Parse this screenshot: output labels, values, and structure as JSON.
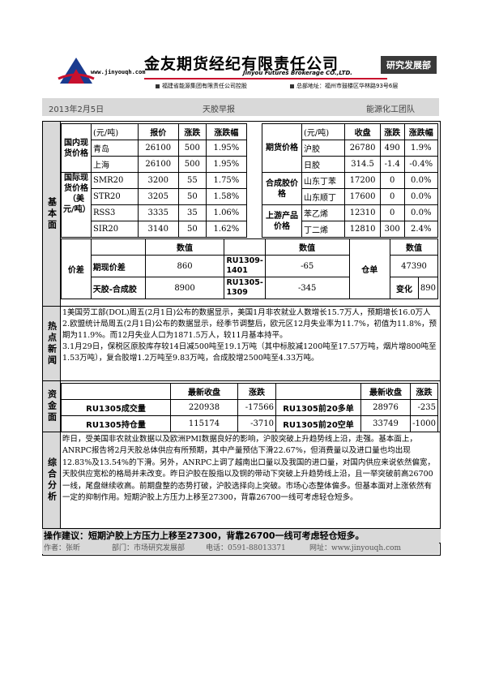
{
  "header": {
    "company_cn": "金友期货经纪有限责任公司",
    "url": "www.jinyouqh.com",
    "company_en": "Jinyou Futures Brokerage CO.,LTD.",
    "dept_badge": "研究发展部",
    "sub_left": "福建省能源集团有限责任公司控股",
    "sub_right": "总部地址：福州市鼓楼区华林路93号6层"
  },
  "topbar": {
    "date": "2013年2月5日",
    "title": "天胶早报",
    "team": "能源化工团队"
  },
  "sections": {
    "basic": "基本面",
    "hot": "热点新闻",
    "funds": "资金面",
    "analysis": "综合分析"
  },
  "domestic_spot": {
    "label": "国内现货价格",
    "headers": [
      "(元/吨)",
      "报价",
      "涨跌",
      "涨跌幅"
    ],
    "rows": [
      [
        "青岛",
        "26100",
        "500",
        "1.95%"
      ],
      [
        "上海",
        "26100",
        "500",
        "1.95%"
      ]
    ]
  },
  "intl_spot": {
    "label": "国际现货价格（美元/吨）",
    "rows": [
      [
        "SMR20",
        "3200",
        "55",
        "1.75%"
      ],
      [
        "STR20",
        "3205",
        "50",
        "1.58%"
      ],
      [
        "RSS3",
        "3335",
        "35",
        "1.06%"
      ],
      [
        "SIR20",
        "3140",
        "50",
        "1.62%"
      ]
    ]
  },
  "futures": {
    "label": "期货价格",
    "headers": [
      "(元/吨)",
      "收盘",
      "涨跌",
      "涨跌幅"
    ],
    "rows": [
      [
        "沪胶",
        "26780",
        "490",
        "1.9%"
      ],
      [
        "日胶",
        "314.5",
        "-1.4",
        "-0.4%"
      ]
    ]
  },
  "synthetic": {
    "label": "合成胶价格",
    "rows": [
      [
        "山东丁苯",
        "17200",
        "0",
        "0.0%"
      ],
      [
        "山东顺丁",
        "17600",
        "0",
        "0.0%"
      ]
    ]
  },
  "upstream": {
    "label": "上游产品价格",
    "rows": [
      [
        "苯乙烯",
        "12310",
        "0",
        "0.0%"
      ],
      [
        "丁二烯",
        "12810",
        "300",
        "2.4%"
      ]
    ]
  },
  "spread": {
    "label": "价差",
    "value_header": "数值",
    "rows": [
      {
        "name": "期现价差",
        "value": "860",
        "contract": "RU1309-1401",
        "contract_value": "-65"
      },
      {
        "name": "天胶-合成胶",
        "value": "8900",
        "contract": "RU1305-1309",
        "contract_value": "-345"
      }
    ],
    "warrant_label": "仓单",
    "warrant_value": "47390",
    "change_label": "变化",
    "change_value": "890"
  },
  "hot_news": [
    "1美国劳工部(DOL)周五(2月1日)公布的数据显示，美国1月非农就业人数增长15.7万人，预期增长16.0万人",
    "2.欧盟统计局周五(2月1日)公布的数据显示，经季节调整后，欧元区12月失业率为11.7%，初值为11.8%，预期为11.9%。而12月失业人口为1871.5万人，较11月基本持平。",
    "3.1月29日，保税区原胶库存较14日减500吨至19.1万吨（其中标胶减1200吨至17.57万吨，烟片增800吨至1.53万吨），复合胶增1.2万吨至9.83万吨，合成胶增2500吨至4.33万吨。"
  ],
  "funds": {
    "headers": [
      "最新收盘",
      "涨跌",
      "最新收盘",
      "涨跌"
    ],
    "rows": [
      {
        "name": "RU1305成交量",
        "close": "220938",
        "change": "-17566",
        "name2": "RU1305前20多单",
        "close2": "28976",
        "change2": "-235"
      },
      {
        "name": "RU1305持仓量",
        "close": "115174",
        "change": "-3710",
        "name2": "RU1305前20空单",
        "close2": "33749",
        "change2": "-1000"
      }
    ]
  },
  "analysis_text": "昨日，受美国非农就业数据以及欧洲PMI数据良好的影响，沪胶突破上升趋势线上沿，走强。基本面上，ANRPC报告将2月天胶总体供应有所预期，其中产量预估下滑22.67%，但消费量以及进口量也均出现12.83%及13.54%的下滑。另外，ANRPC上调了越南出口量以及我国的进口量，对国内供应来说依然偏宽，天胶供应宽松的格局并未改变。昨日沪胶在股指以及铜的带动下突破上升趋势线上沿，且一举突破前高26700一线，尾盘继续收高。前期盘整的态势打破，沪胶选择向上突破。市场心态整体偏多。但基本面对上涨依然有一定的抑制作用。短期沪胶上方压力上移至27300，背靠26700一线可考虑轻仓短多。",
  "advice": "操作建议：短期沪胶上方压力上移至27300，背靠26700一线可考虑轻仓短多。",
  "footer": {
    "author": "作者：张昕",
    "dept": "部门：市场研究发展部",
    "phone": "电话：0591-88013371",
    "site": "网址：www.jinyouqh.com"
  },
  "colors": {
    "accent_red": "#c8102e",
    "section_gray": "#d9d9d9"
  }
}
